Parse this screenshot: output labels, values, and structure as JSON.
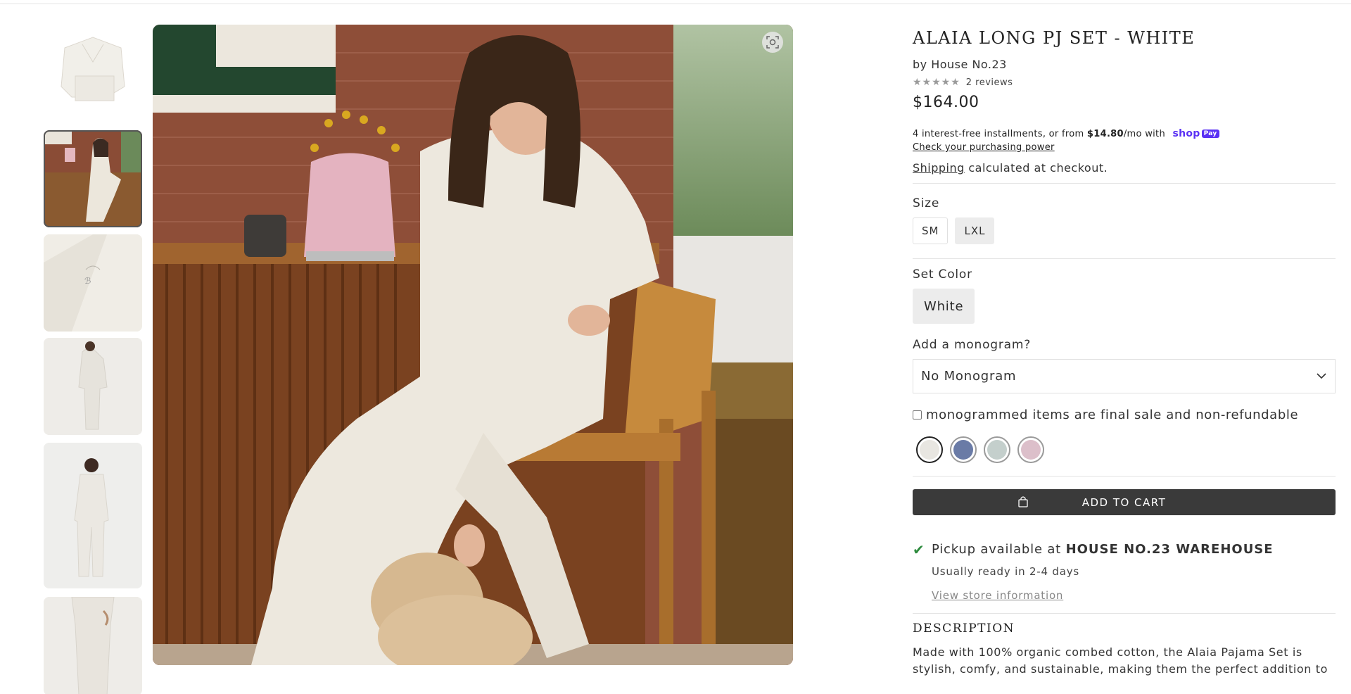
{
  "product": {
    "title": "ALAIA LONG PJ SET - WHITE",
    "vendor": "by House No.23",
    "stars": "★★★★★",
    "reviews": "2 reviews",
    "price": "$164.00",
    "rating_value": 5
  },
  "payment": {
    "installments_prefix": "4 interest-free installments, or from ",
    "installment_amount": "$14.80",
    "installments_suffix": "/mo with",
    "shoppay_label": "shop",
    "shoppay_badge": "Pay",
    "check_power": "Check your purchasing power",
    "shipping_link": "Shipping",
    "shipping_text": " calculated at checkout."
  },
  "size": {
    "label": "Size",
    "options": [
      "SM",
      "LXL"
    ],
    "selected": "LXL"
  },
  "set_color": {
    "label": "Set Color",
    "value": "White"
  },
  "monogram": {
    "label": "Add a monogram?",
    "selected": "No Monogram",
    "final_sale_text": "monogrammed items are final sale and non-refundable",
    "swatch_colors": [
      "#e8e6e1",
      "#6a7ba6",
      "#c4cfcc",
      "#dcbfca"
    ],
    "selected_swatch": 0
  },
  "cart": {
    "button_label": "ADD TO CART"
  },
  "pickup": {
    "prefix": "Pickup available at ",
    "location": "HOUSE NO.23 WAREHOUSE",
    "ready": "Usually ready in 2-4 days",
    "view_store": "View store information"
  },
  "description": {
    "title": "DESCRIPTION",
    "text": "Made with 100% organic combed cotton, the Alaia Pajama Set is stylish, comfy, and sustainable, making them the perfect addition to"
  },
  "colors": {
    "accent_dark": "#3a3a3a",
    "check_green": "#2e8b3e",
    "shoppay_purple": "#5a31f4"
  }
}
